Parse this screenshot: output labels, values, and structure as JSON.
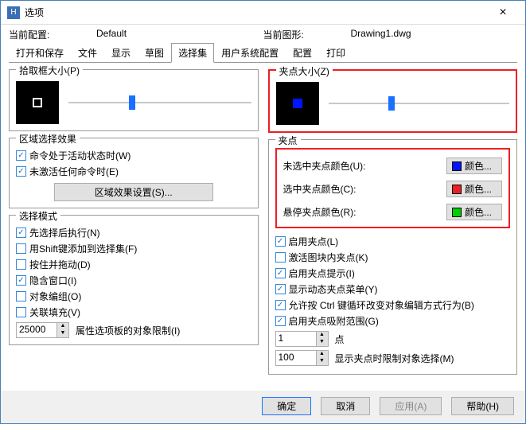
{
  "window": {
    "title": "选项"
  },
  "info": {
    "current_config_label": "当前配置:",
    "current_config_value": "Default",
    "current_drawing_label": "当前图形:",
    "current_drawing_value": "Drawing1.dwg"
  },
  "tabs": [
    "打开和保存",
    "文件",
    "显示",
    "草图",
    "选择集",
    "用户系统配置",
    "配置",
    "打印"
  ],
  "pickbox": {
    "title": "拾取框大小(P)"
  },
  "pick_slider_pos": "33%",
  "grip_slider_pos": "33%",
  "area": {
    "title": "区域选择效果",
    "cmd_active": "命令处于活动状态时(W)",
    "no_cmd": "未激活任何命令时(E)",
    "settings_btn": "区域效果设置(S)..."
  },
  "selmode": {
    "title": "选择模式",
    "pre_exec": "先选择后执行(N)",
    "shift_add": "用Shift键添加到选择集(F)",
    "press_drag": "按住并拖动(D)",
    "implied_win": "隐含窗口(I)",
    "obj_group": "对象编组(O)",
    "assoc_fill": "关联填充(V)",
    "limit_label": "属性选项板的对象限制(I)",
    "limit_val": "25000"
  },
  "gripbox": {
    "title": "夹点大小(Z)"
  },
  "gripcolors": {
    "unsel_label": "未选中夹点颜色(U):",
    "sel_label": "选中夹点颜色(C):",
    "hover_label": "悬停夹点颜色(R):",
    "btn_text": "颜色...",
    "unsel": "#0015ff",
    "sel": "#ec2024",
    "hover": "#00d000"
  },
  "gripopts": {
    "title": "夹点",
    "enable": "启用夹点(L)",
    "in_block": "激活图块内夹点(K)",
    "tips": "启用夹点提示(I)",
    "dyn_menu": "显示动态夹点菜单(Y)",
    "ctrl_cycle": "允许按 Ctrl 键循环改变对象编辑方式行为(B)",
    "snap_range": "启用夹点吸附范围(G)",
    "pt_label": "点",
    "pt_val": "1",
    "limit_label": "显示夹点时限制对象选择(M)",
    "limit_val": "100"
  },
  "buttons": {
    "ok": "确定",
    "cancel": "取消",
    "apply": "应用(A)",
    "help": "帮助(H)"
  }
}
